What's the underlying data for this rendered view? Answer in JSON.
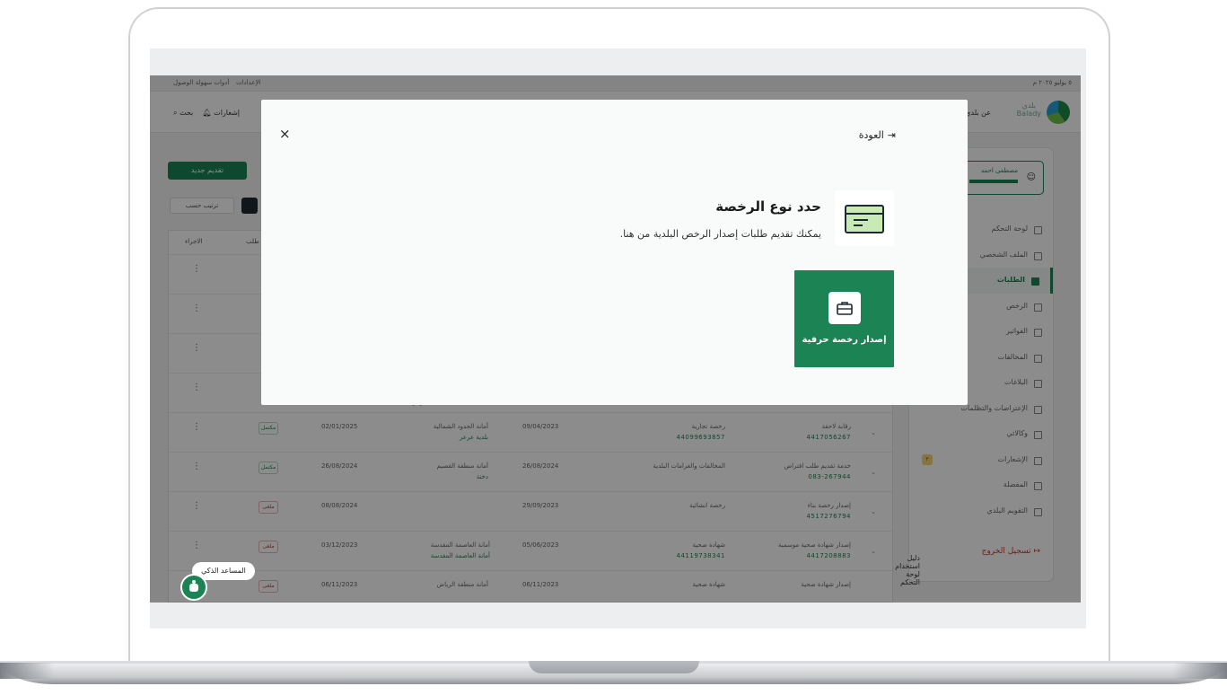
{
  "app": {
    "topbar": {
      "date": "٥ يوليو ٢٠٢٥ م",
      "settings": "الإعدادات",
      "accessibility": "أدوات سهولة الوصول"
    },
    "header": {
      "logo_line1": "بلدي",
      "logo_line2": "Balady",
      "nav_about": "عن بلدي",
      "search": "بحث",
      "notifications": "إشعارات"
    },
    "sidebar": {
      "user_name": "مصطفى احمد",
      "items": [
        {
          "label": "لوحة التحكم"
        },
        {
          "label": "الملف الشخصي"
        },
        {
          "label": "الطلبات"
        },
        {
          "label": "الرخص"
        },
        {
          "label": "الفواتير"
        },
        {
          "label": "المخالفات"
        },
        {
          "label": "البلاغات"
        },
        {
          "label": "الإعتراضات والتظلمات"
        },
        {
          "label": "وكالاتي"
        },
        {
          "label": "الإشعارات"
        },
        {
          "label": "المفضلة"
        },
        {
          "label": "التقويم البلدي"
        }
      ],
      "notif_count": "٣",
      "logout": "تسجيل الخروج",
      "footer_link": "دليل استخدام لوحة التحكم"
    },
    "actions": {
      "new_request": "تقديم جديد",
      "sort": "ترتيب حسب"
    },
    "table": {
      "headers": {
        "action": "الاجراء",
        "request": "طلب"
      },
      "rows": [
        {
          "service": "رقابة لاحقة",
          "num": "4417056267",
          "type": "رخصة تجارية",
          "typenum": "44099693857",
          "date1": "09/04/2023",
          "municipality": "أمانة الحدود الشمالية",
          "sub": "بلدية عرعر",
          "date2": "02/01/2025",
          "status": "مكتمل"
        },
        {
          "service": "خدمة تقديم طلب افتراض",
          "num": "083-267944",
          "type": "المخالفات والغرامات البلدية",
          "typenum": "",
          "date1": "26/08/2024",
          "municipality": "أمانة منطقة القصيم",
          "sub": "دخنة",
          "date2": "26/08/2024",
          "status": "مكتمل"
        },
        {
          "service": "إصدار رخصة بناء",
          "num": "4517276794",
          "type": "رخصة انشائية",
          "typenum": "",
          "date1": "29/09/2023",
          "municipality": "",
          "sub": "",
          "date2": "08/08/2024",
          "status": "ملغى"
        },
        {
          "service": "إصدار شهادة صحية موسمية",
          "num": "4417208883",
          "type": "شهادة صحية",
          "typenum": "44119738341",
          "date1": "05/06/2023",
          "municipality": "أمانة العاصمة المقدسة",
          "sub": "أمانة العاصمة المقدسة",
          "date2": "03/12/2023",
          "status": "ملغى"
        },
        {
          "service": "إصدار شهادة صحية",
          "num": "",
          "type": "شهادة صحية",
          "typenum": "",
          "date1": "06/11/2023",
          "municipality": "أمانة منطقة الرياض",
          "sub": "",
          "date2": "06/11/2023",
          "status": "ملغى"
        }
      ],
      "partial_sub": "بلدية عرعر"
    }
  },
  "modal": {
    "back": "العودة",
    "close": "×",
    "title": "حدد نوع الرخصة",
    "subtitle": "يمكنك تقديم طلبات إصدار الرخص البلدية من هنا.",
    "card_label": "إصدار رخصة حرفية"
  },
  "assistant": {
    "label": "المساعد الذكي"
  },
  "colors": {
    "brand_green": "#1b8354",
    "icon_fill": "#c9eab5"
  }
}
